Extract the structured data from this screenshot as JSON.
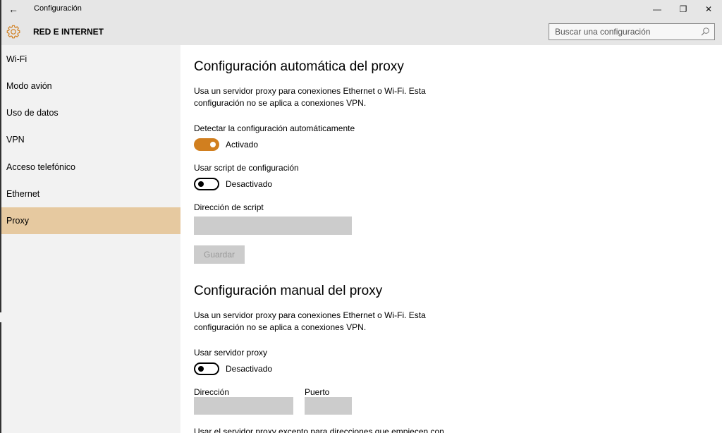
{
  "window": {
    "title": "Configuración",
    "controls": {
      "minimize": "—",
      "maximize": "❐",
      "close": "✕"
    }
  },
  "header": {
    "title": "RED E INTERNET",
    "search_placeholder": "Buscar una configuración"
  },
  "colors": {
    "accent": "#d17f1f",
    "selected_nav": "#e6c9a0",
    "sidebar_bg": "#f2f2f2",
    "titlebar_bg": "#e6e6e6",
    "disabled_field": "#cccccc"
  },
  "sidebar": {
    "items": [
      {
        "label": "Wi-Fi",
        "active": false
      },
      {
        "label": "Modo avión",
        "active": false
      },
      {
        "label": "Uso de datos",
        "active": false
      },
      {
        "label": "VPN",
        "active": false
      },
      {
        "label": "Acceso telefónico",
        "active": false
      },
      {
        "label": "Ethernet",
        "active": false
      },
      {
        "label": "Proxy",
        "active": true
      }
    ]
  },
  "auto_proxy": {
    "title": "Configuración automática del proxy",
    "description": "Usa un servidor proxy para conexiones Ethernet o Wi-Fi. Esta configuración no se aplica a conexiones VPN.",
    "detect": {
      "label": "Detectar la configuración automáticamente",
      "state": "Activado",
      "on": true
    },
    "script": {
      "label": "Usar script de configuración",
      "state": "Desactivado",
      "on": false
    },
    "script_address": {
      "label": "Dirección de script",
      "value": ""
    },
    "save_label": "Guardar"
  },
  "manual_proxy": {
    "title": "Configuración manual del proxy",
    "description": "Usa un servidor proxy para conexiones Ethernet o Wi-Fi. Esta configuración no se aplica a conexiones VPN.",
    "use_proxy": {
      "label": "Usar servidor proxy",
      "state": "Desactivado",
      "on": false
    },
    "address": {
      "label": "Dirección",
      "value": ""
    },
    "port": {
      "label": "Puerto",
      "value": ""
    },
    "exceptions_label": "Usar el servidor proxy excepto para direcciones que empiecen con"
  }
}
